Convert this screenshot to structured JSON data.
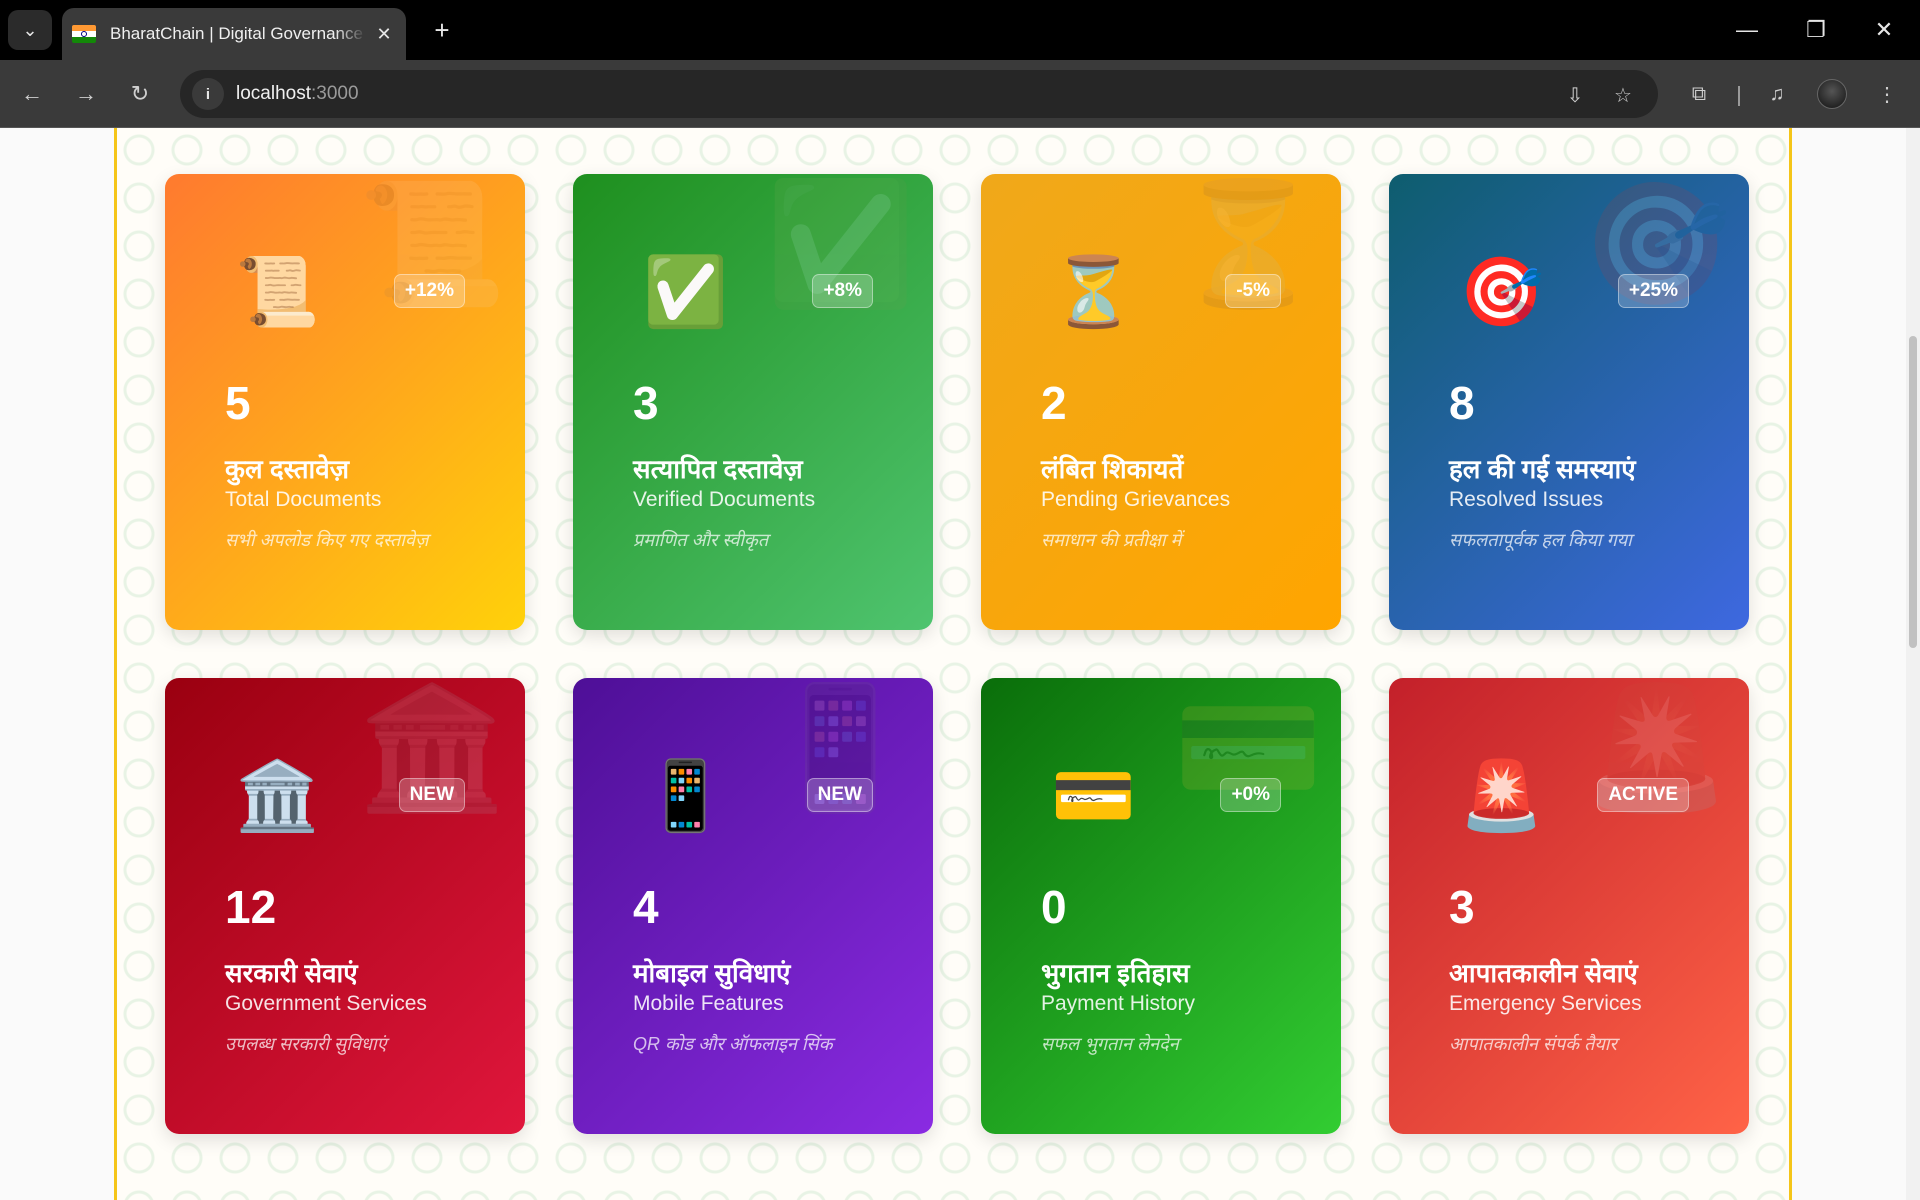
{
  "browser": {
    "tab_title": "BharatChain | Digital Governance",
    "url_host": "localhost",
    "url_port": ":3000",
    "new_tab_label": "+",
    "tab_close_label": "✕"
  },
  "cards": [
    {
      "value": "5",
      "title_hi": "कुल दस्तावेज़",
      "title_en": "Total Documents",
      "desc": "सभी अपलोड किए गए दस्तावेज़",
      "badge": "+12%",
      "icon": "scroll-icon",
      "icon_glyph": "📜",
      "gradient": [
        "#ff7a2f",
        "#ffd10a"
      ]
    },
    {
      "value": "3",
      "title_hi": "सत्यापित दस्तावेज़",
      "title_en": "Verified Documents",
      "desc": "प्रमाणित और स्वीकृत",
      "badge": "+8%",
      "icon": "check-icon",
      "icon_glyph": "✅",
      "gradient": [
        "#1e8f1e",
        "#4fc46f"
      ]
    },
    {
      "value": "2",
      "title_hi": "लंबित शिकायतें",
      "title_en": "Pending Grievances",
      "desc": "समाधान की प्रतीक्षा में",
      "badge": "-5%",
      "icon": "hourglass-icon",
      "icon_glyph": "⏳",
      "gradient": [
        "#f0a81a",
        "#ffa500"
      ]
    },
    {
      "value": "8",
      "title_hi": "हल की गई समस्याएं",
      "title_en": "Resolved Issues",
      "desc": "सफलतापूर्वक हल किया गया",
      "badge": "+25%",
      "icon": "target-icon",
      "icon_glyph": "🎯",
      "gradient": [
        "#0e5d6e",
        "#3e68e0"
      ]
    },
    {
      "value": "12",
      "title_hi": "सरकारी सेवाएं",
      "title_en": "Government Services",
      "desc": "उपलब्ध सरकारी सुविधाएं",
      "badge": "NEW",
      "icon": "bank-icon",
      "icon_glyph": "🏛️",
      "gradient": [
        "#9a0010",
        "#e0163c"
      ]
    },
    {
      "value": "4",
      "title_hi": "मोबाइल सुविधाएं",
      "title_en": "Mobile Features",
      "desc": "QR कोड और ऑफलाइन सिंक",
      "badge": "NEW",
      "icon": "mobile-icon",
      "icon_glyph": "📱",
      "gradient": [
        "#4e0f97",
        "#8a2be2"
      ]
    },
    {
      "value": "0",
      "title_hi": "भुगतान इतिहास",
      "title_en": "Payment History",
      "desc": "सफल भुगतान लेनदेन",
      "badge": "+0%",
      "icon": "credit-card-icon",
      "icon_glyph": "💳",
      "gradient": [
        "#0a6e0a",
        "#32cd32"
      ]
    },
    {
      "value": "3",
      "title_hi": "आपातकालीन सेवाएं",
      "title_en": "Emergency Services",
      "desc": "आपातकालीन संपर्क तैयार",
      "badge": "ACTIVE",
      "icon": "siren-icon",
      "icon_glyph": "🚨",
      "gradient": [
        "#c3202a",
        "#ff6347"
      ]
    }
  ]
}
